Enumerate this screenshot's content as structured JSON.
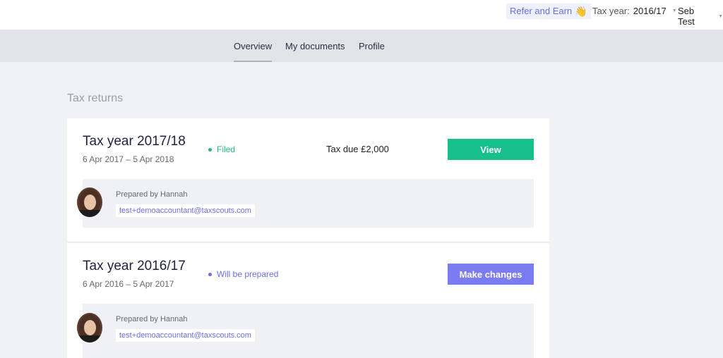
{
  "header": {
    "refer_label": "Refer and Earn",
    "refer_icon": "waving-hand-icon",
    "tax_year_label": "Tax year:",
    "tax_year_value": "2016/17",
    "user_name": "Seb Test"
  },
  "nav": {
    "tabs": [
      {
        "label": "Overview",
        "active": true
      },
      {
        "label": "My documents",
        "active": false
      },
      {
        "label": "Profile",
        "active": false
      }
    ]
  },
  "main": {
    "section_title": "Tax returns",
    "returns": [
      {
        "title": "Tax year 2017/18",
        "dates": "6 Apr 2017 – 5 Apr 2018",
        "status": "Filed",
        "tax_due": "Tax due £2,000",
        "button_label": "View",
        "prepared_by": "Prepared by Hannah",
        "email": "test+demoaccountant@taxscouts.com"
      },
      {
        "title": "Tax year 2016/17",
        "dates": "6 Apr 2016 – 5 Apr 2017",
        "status": "Will be prepared",
        "tax_due": "",
        "button_label": "Make changes",
        "prepared_by": "Prepared by Hannah",
        "email": "test+demoaccountant@taxscouts.com"
      }
    ]
  },
  "colors": {
    "filed": "#1fb67c",
    "will_be_prepared": "#6b6fe0",
    "view_button": "#17c08a",
    "make_changes_button": "#7b7cf2"
  }
}
